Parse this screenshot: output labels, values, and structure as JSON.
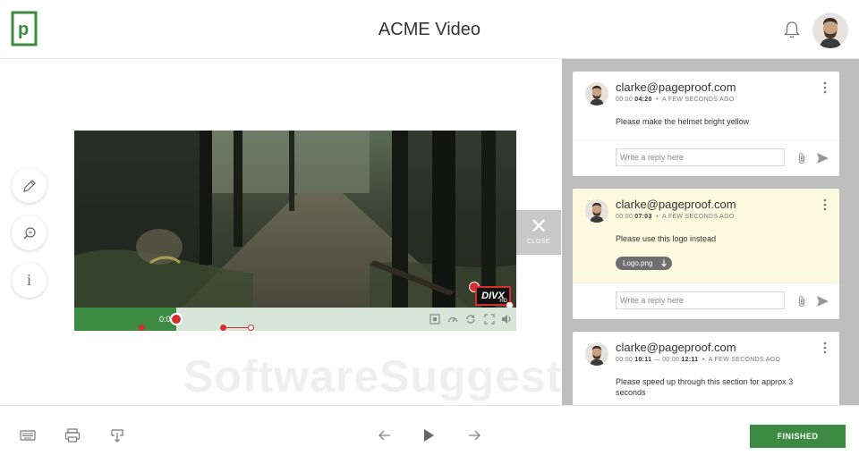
{
  "header": {
    "app_title": "ACME Video",
    "logo_letter": "p"
  },
  "colors": {
    "brand_green": "#3d8a42",
    "annotation_red": "#d32f2f",
    "highlight_card": "#fdfbdf"
  },
  "tools": [
    {
      "name": "pen-icon"
    },
    {
      "name": "zoom-icon"
    },
    {
      "name": "info-icon",
      "glyph": "i"
    }
  ],
  "video": {
    "divx_label": "DIVX",
    "divx_sub": "HD",
    "current_time": "0:07",
    "progress": 0.23
  },
  "close_tab": {
    "glyph": "✕",
    "label": "CLOSE"
  },
  "watermark": "SoftwareSuggest.com",
  "comments": [
    {
      "author": "clarke@pageproof.com",
      "time": "00:00:",
      "time_bold": "04:20",
      "ago": "A FEW SECONDS AGO",
      "text": "Please make the helmet bright yellow",
      "reply_placeholder": "Write a reply here"
    },
    {
      "author": "clarke@pageproof.com",
      "time": "00:00:",
      "time_bold": "07:03",
      "ago": "A FEW SECONDS AGO",
      "text": "Please use this logo instead",
      "attachment": "Logo.png",
      "reply_placeholder": "Write a reply here"
    },
    {
      "author": "clarke@pageproof.com",
      "time": "00:00:",
      "time_bold": "10:11",
      "time_mid": " — 00:00:",
      "time_bold2": "12:11",
      "ago": "A FEW SECONDS AGO",
      "text": "Please speed up through this section for approx 3 seconds"
    }
  ],
  "footer": {
    "finished_label": "FINISHED"
  }
}
